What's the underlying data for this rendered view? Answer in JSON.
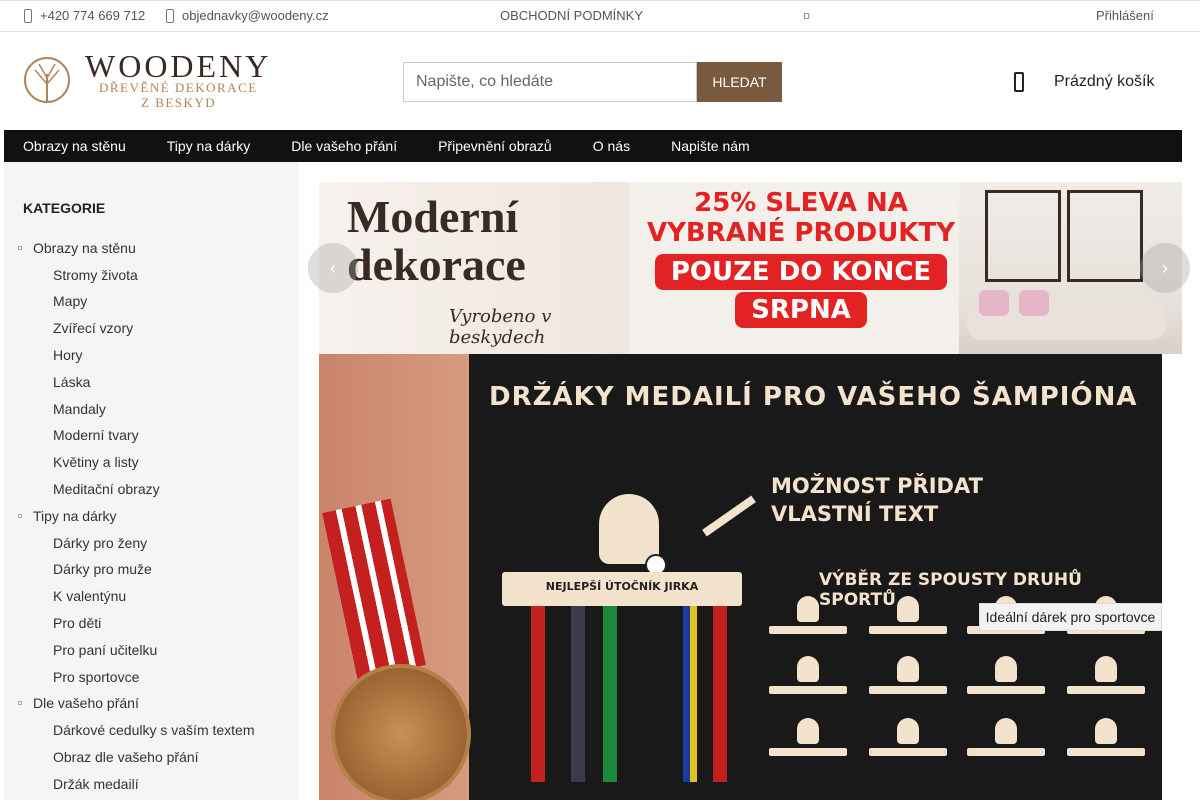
{
  "topbar": {
    "phone": "+420 774 669 712",
    "email": "objednavky@woodeny.cz",
    "terms": "OBCHODNÍ PODMÍNKY",
    "login": "Přihlášení"
  },
  "logo": {
    "title": "WOODENY",
    "subtitle_line1": "DŘEVĚNÉ DEKORACE",
    "subtitle_line2": "Z BESKYD"
  },
  "search": {
    "placeholder": "Napište, co hledáte",
    "button": "HLEDAT"
  },
  "cart": {
    "label": "Prázdný košík"
  },
  "nav": {
    "items": [
      "Obrazy na stěnu",
      "Tipy na dárky",
      "Dle vašeho přání",
      "Připevnění obrazů",
      "O nás",
      "Napište nám"
    ]
  },
  "sidebar": {
    "heading": "KATEGORIE",
    "groups": [
      {
        "label": "Obrazy na stěnu",
        "children": [
          "Stromy života",
          "Mapy",
          "Zvířecí vzory",
          "Hory",
          "Láska",
          "Mandaly",
          "Moderní tvary",
          "Květiny a listy",
          "Meditační obrazy"
        ]
      },
      {
        "label": "Tipy na dárky",
        "children": [
          "Dárky pro ženy",
          "Dárky pro muže",
          "K valentýnu",
          "Pro děti",
          "Pro paní učitelku",
          "Pro sportovce"
        ]
      },
      {
        "label": "Dle vašeho přání",
        "children": [
          "Dárkové cedulky s vaším textem",
          "Obraz dle vašeho přání",
          "Držák medailí"
        ]
      }
    ]
  },
  "banner1": {
    "title_line1": "Moderní",
    "title_line2": "dekorace",
    "script": "Vyrobeno v beskydech",
    "promo_line1": "25% SLEVA NA",
    "promo_line2": "VYBRANÉ PRODUKTY",
    "promo_line3": "POUZE DO KONCE",
    "promo_line4": "SRPNA"
  },
  "banner2": {
    "title": "DRŽÁKY MEDAILÍ PRO VAŠEHO ŠAMPIÓNA",
    "sub1": "MOŽNOST PŘIDAT",
    "sub2": "VLASTNÍ TEXT",
    "sports": "VÝBĚR ZE SPOUSTY DRUHŮ SPORTŮ",
    "rack_text": "NEJLEPŠÍ ÚTOČNÍK JIRKA",
    "tooltip": "Ideální dárek pro sportovce"
  },
  "colors": {
    "accent": "#7a5a3e",
    "nav_bg": "#111111",
    "promo_red": "#e32323",
    "sidebar_bg": "#f5f5f5"
  }
}
